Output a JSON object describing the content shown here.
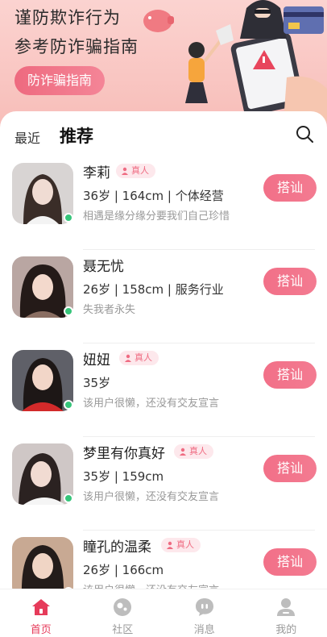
{
  "banner": {
    "line1": "谨防欺诈行为",
    "line2": "参考防诈骗指南",
    "guide_button": "防诈骗指南"
  },
  "tabs": {
    "recent": "最近",
    "recommend": "推荐"
  },
  "users": [
    {
      "name": "李莉",
      "verified": true,
      "verified_label": "真人",
      "info": "36岁 | 164cm | 个体经营",
      "motto": "相遇是缘分缘分要我们自己珍惜",
      "online": true,
      "action": "搭讪"
    },
    {
      "name": "聂无忧",
      "verified": false,
      "verified_label": "",
      "info": "26岁 | 158cm | 服务行业",
      "motto": "失我者永失",
      "online": true,
      "action": "搭讪"
    },
    {
      "name": "妞妞",
      "verified": true,
      "verified_label": "真人",
      "info": "35岁",
      "motto": "该用户很懒，还没有交友宣言",
      "online": true,
      "action": "搭讪"
    },
    {
      "name": "梦里有你真好",
      "verified": true,
      "verified_label": "真人",
      "info": "35岁 | 159cm",
      "motto": "该用户很懒，还没有交友宣言",
      "online": true,
      "action": "搭讪"
    },
    {
      "name": "瞳孔的温柔",
      "verified": true,
      "verified_label": "真人",
      "info": "26岁 | 166cm",
      "motto": "该用户很懒，还没有交友宣言",
      "online": true,
      "action": "搭讪"
    }
  ],
  "nav": {
    "items": [
      {
        "label": "首页",
        "icon": "home-icon",
        "active": true
      },
      {
        "label": "社区",
        "icon": "community-icon",
        "active": false
      },
      {
        "label": "消息",
        "icon": "message-icon",
        "active": false
      },
      {
        "label": "我的",
        "icon": "profile-icon",
        "active": false
      }
    ]
  },
  "colors": {
    "accent": "#f27088",
    "nav_active": "#e63b5a",
    "online": "#36c57a",
    "banner_bg": "#f9c6c2"
  }
}
